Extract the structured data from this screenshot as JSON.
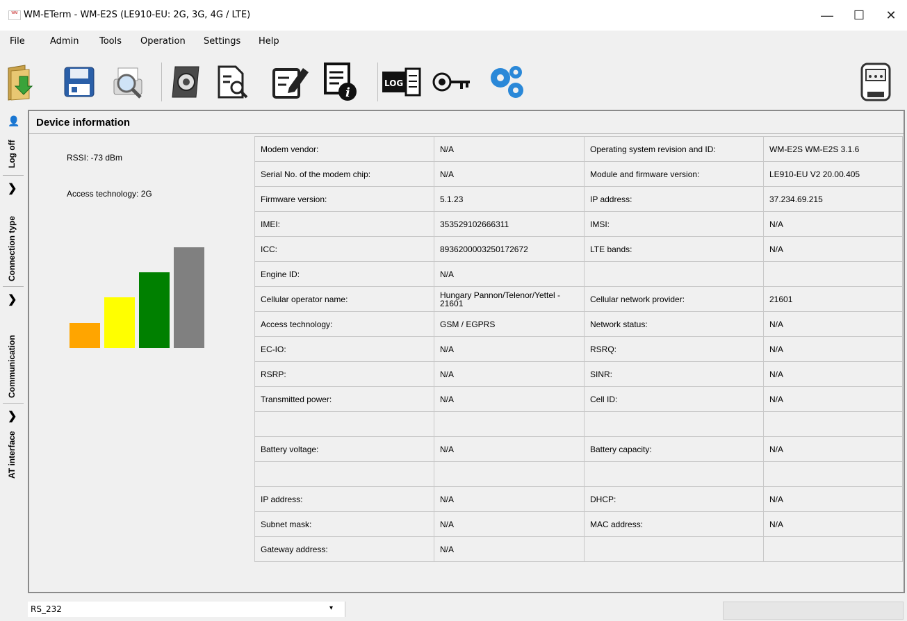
{
  "window": {
    "title": "WM-ETerm - WM-E2S (LE910-EU: 2G, 3G, 4G / LTE)",
    "minimize": "—",
    "maximize": "☐",
    "close": "✕"
  },
  "menu": [
    "File",
    "Admin",
    "Tools",
    "Operation",
    "Settings",
    "Help"
  ],
  "toolbar": {
    "icons": [
      "open-folder-icon",
      "save-disk-icon",
      "print-preview-icon",
      "config-book-icon",
      "document-search-icon",
      "edit-document-icon",
      "device-info-icon",
      "log-icon",
      "key-refresh-icon",
      "gears-icon",
      "meter-icon"
    ],
    "log_label": "LOG"
  },
  "left_tabs": {
    "log_off": "Log off",
    "connection_type": "Connection type",
    "communication": "Communication",
    "at_interface": "AT interface"
  },
  "panel": {
    "title": "Device information",
    "rssi": "RSSI: -73 dBm",
    "access_technology": "Access technology: 2G",
    "signal_bars": [
      {
        "color": "#ffa500",
        "level": 0.25
      },
      {
        "color": "#ffff00",
        "level": 0.5
      },
      {
        "color": "#008000",
        "level": 0.75
      },
      {
        "color": "#808080",
        "level": 1.0
      }
    ]
  },
  "rows": [
    [
      "Modem vendor:",
      "N/A",
      "Operating system revision and ID:",
      "WM-E2S WM-E2S 3.1.6"
    ],
    [
      "Serial No. of the modem chip:",
      "N/A",
      "Module and firmware version:",
      "LE910-EU V2 20.00.405"
    ],
    [
      "Firmware version:",
      "5.1.23",
      "IP address:",
      "37.234.69.215"
    ],
    [
      "IMEI:",
      "353529102666311",
      "IMSI:",
      "N/A"
    ],
    [
      "ICC:",
      "8936200003250172672",
      "LTE bands:",
      "N/A"
    ],
    [
      "Engine ID:",
      "N/A",
      "",
      ""
    ],
    [
      "Cellular operator name:",
      "Hungary Pannon/Telenor/Yettel - 21601",
      "Cellular network provider:",
      "21601"
    ],
    [
      "Access technology:",
      "GSM / EGPRS",
      "Network status:",
      "N/A"
    ],
    [
      "EC-IO:",
      "N/A",
      "RSRQ:",
      "N/A"
    ],
    [
      "RSRP:",
      "N/A",
      "SINR:",
      "N/A"
    ],
    [
      "Transmitted power:",
      "N/A",
      "Cell ID:",
      "N/A"
    ],
    [
      "",
      "",
      "",
      ""
    ],
    [
      "Battery voltage:",
      "N/A",
      "Battery capacity:",
      "N/A"
    ],
    [
      "",
      "",
      "",
      ""
    ],
    [
      "IP address:",
      "N/A",
      "DHCP:",
      "N/A"
    ],
    [
      "Subnet mask:",
      "N/A",
      "MAC address:",
      "N/A"
    ],
    [
      "Gateway address:",
      "N/A",
      "",
      ""
    ]
  ],
  "status": {
    "port": "RS_232",
    "arrow": "▾"
  }
}
